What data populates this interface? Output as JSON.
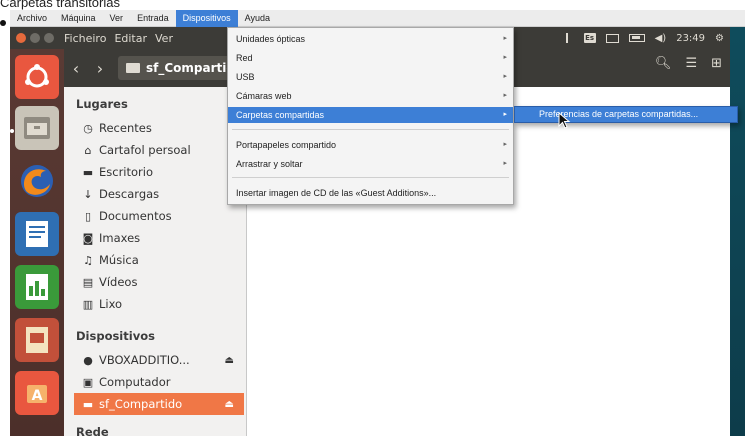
{
  "caption": "Carpetas transitorias",
  "vbox_menubar": {
    "items": [
      "Archivo",
      "Máquina",
      "Ver",
      "Entrada",
      "Dispositivos",
      "Ayuda"
    ],
    "active_index": 4
  },
  "ubuntu_panel": {
    "app_menu": [
      "Ficheiro",
      "Editar",
      "Ver"
    ],
    "keyboard_indicator": "Es",
    "clock": "23:49"
  },
  "nautilus": {
    "path_button": "sf_Compartido",
    "sidebar": {
      "sections": [
        {
          "title": "Lugares",
          "items": [
            {
              "label": "Recentes",
              "icon": "clock-icon"
            },
            {
              "label": "Cartafol persoal",
              "icon": "home-icon"
            },
            {
              "label": "Escritorio",
              "icon": "desktop-icon"
            },
            {
              "label": "Descargas",
              "icon": "download-icon"
            },
            {
              "label": "Documentos",
              "icon": "document-icon"
            },
            {
              "label": "Imaxes",
              "icon": "camera-icon"
            },
            {
              "label": "Música",
              "icon": "music-icon"
            },
            {
              "label": "Vídeos",
              "icon": "video-icon"
            },
            {
              "label": "Lixo",
              "icon": "trash-icon"
            }
          ]
        },
        {
          "title": "Dispositivos",
          "items": [
            {
              "label": "VBOXADDITIO...",
              "icon": "disc-icon",
              "eject": true
            },
            {
              "label": "Computador",
              "icon": "computer-icon"
            },
            {
              "label": "sf_Compartido",
              "icon": "folder-icon",
              "eject": true,
              "selected": true
            }
          ]
        },
        {
          "title": "Rede",
          "items": []
        }
      ]
    }
  },
  "dropdown": {
    "items": [
      {
        "label": "Unidades ópticas",
        "submenu": true
      },
      {
        "label": "Red",
        "submenu": true
      },
      {
        "label": "USB",
        "submenu": true
      },
      {
        "label": "Cámaras web",
        "submenu": true
      },
      {
        "label": "Carpetas compartidas",
        "submenu": true,
        "highlighted": true
      },
      {
        "label": "Portapapeles compartido",
        "submenu": true
      },
      {
        "label": "Arrastrar y soltar",
        "submenu": true
      },
      {
        "label": "Insertar imagen de CD de las «Guest Additions»...",
        "submenu": false
      }
    ],
    "submenu_item": "Preferencias de carpetas compartidas..."
  },
  "colors": {
    "menu_highlight": "#3d7fd6",
    "sidebar_selected": "#f07746",
    "panel": "#3c3b37",
    "launcher": "#5a3a34"
  }
}
